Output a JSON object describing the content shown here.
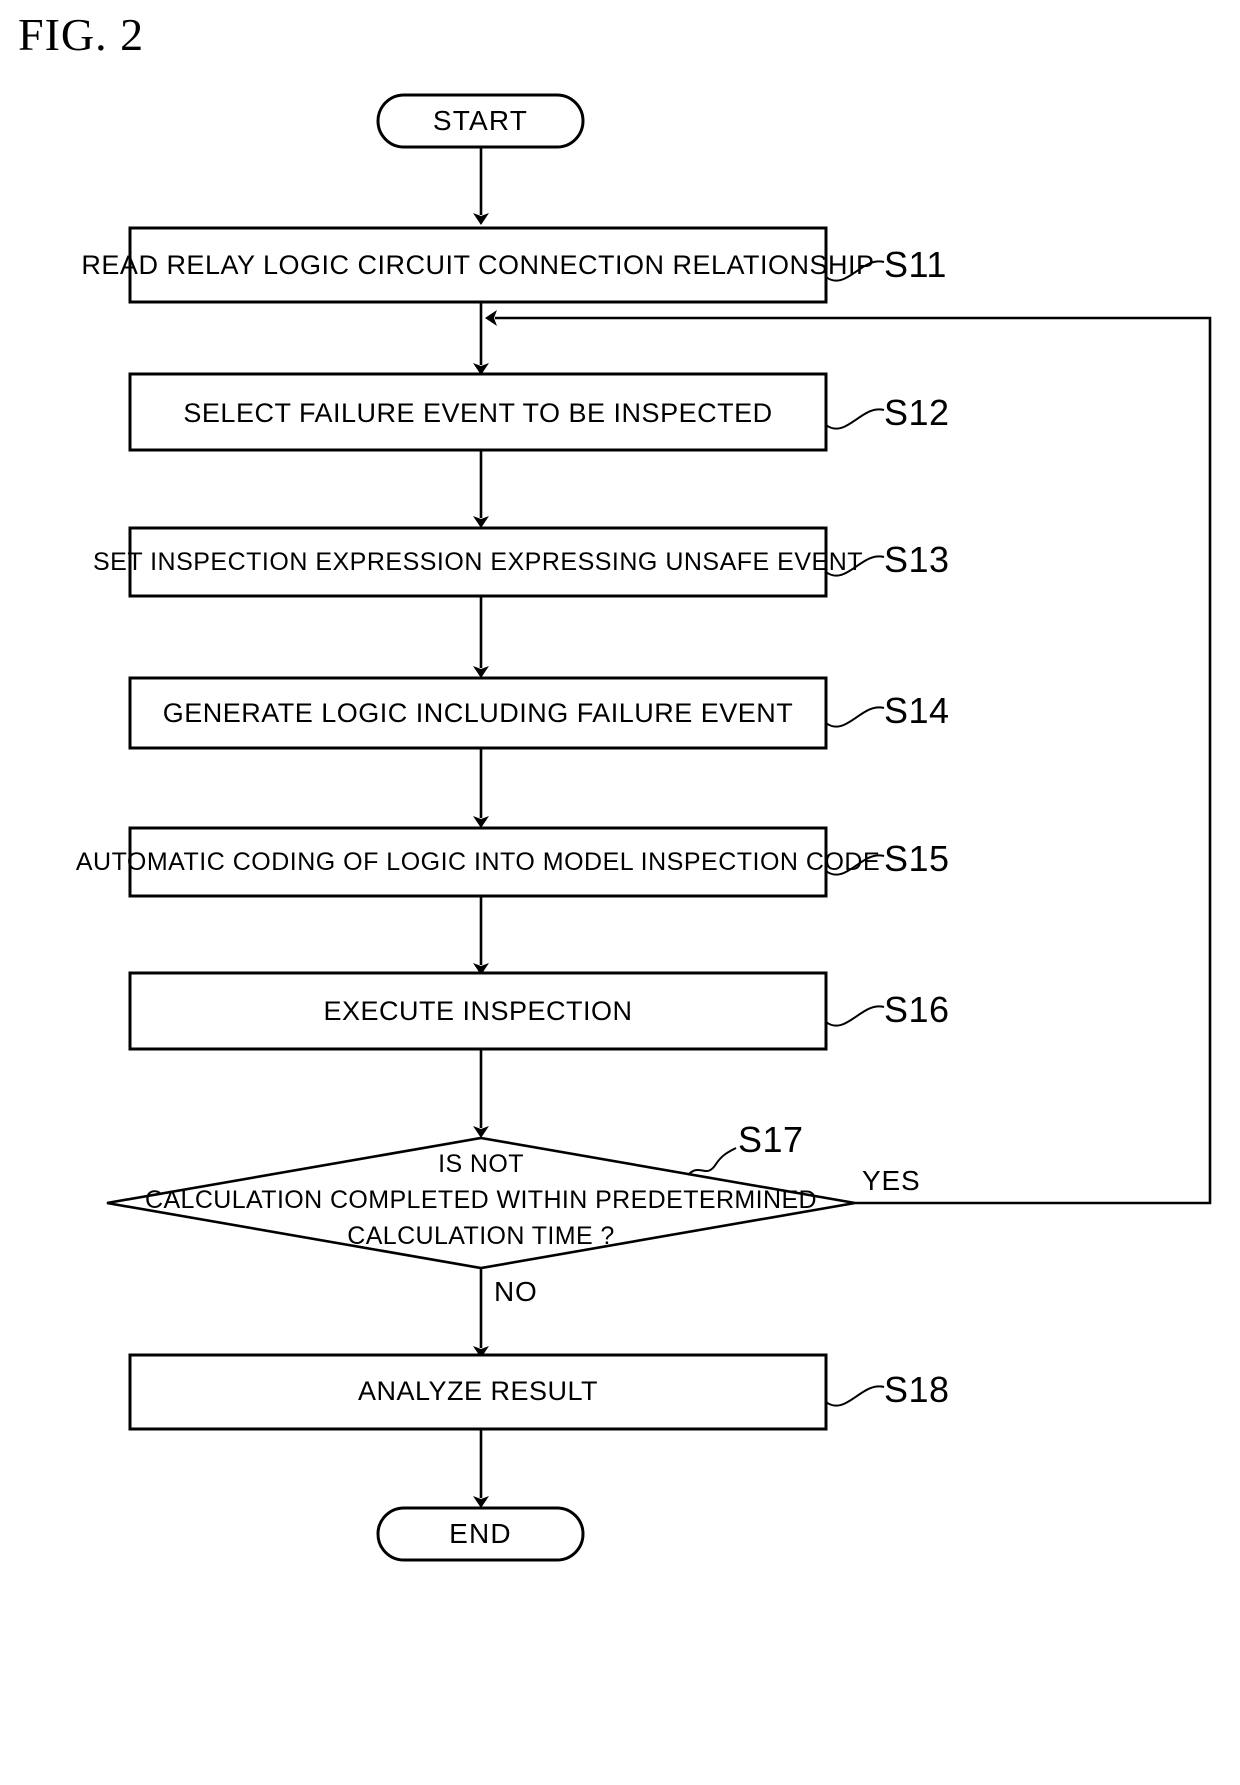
{
  "figure": {
    "title": "FIG. 2"
  },
  "flowchart": {
    "start_label": "START",
    "end_label": "END",
    "yes_label": "YES",
    "no_label": "NO",
    "steps": [
      {
        "id": "S11",
        "text": "READ RELAY LOGIC CIRCUIT CONNECTION RELATIONSHIP"
      },
      {
        "id": "S12",
        "text": "SELECT FAILURE EVENT TO BE INSPECTED"
      },
      {
        "id": "S13",
        "text": "SET INSPECTION EXPRESSION EXPRESSING UNSAFE EVENT"
      },
      {
        "id": "S14",
        "text": "GENERATE LOGIC INCLUDING FAILURE EVENT"
      },
      {
        "id": "S15",
        "text": "AUTOMATIC CODING OF LOGIC INTO MODEL INSPECTION CODE"
      },
      {
        "id": "S16",
        "text": "EXECUTE INSPECTION"
      },
      {
        "id": "S18",
        "text": "ANALYZE RESULT"
      }
    ],
    "decision": {
      "id": "S17",
      "line1": "IS NOT",
      "line2": "CALCULATION COMPLETED WITHIN PREDETERMINED",
      "line3": "CALCULATION TIME ?"
    }
  },
  "colors": {
    "line": "#000000",
    "fill": "#ffffff"
  }
}
